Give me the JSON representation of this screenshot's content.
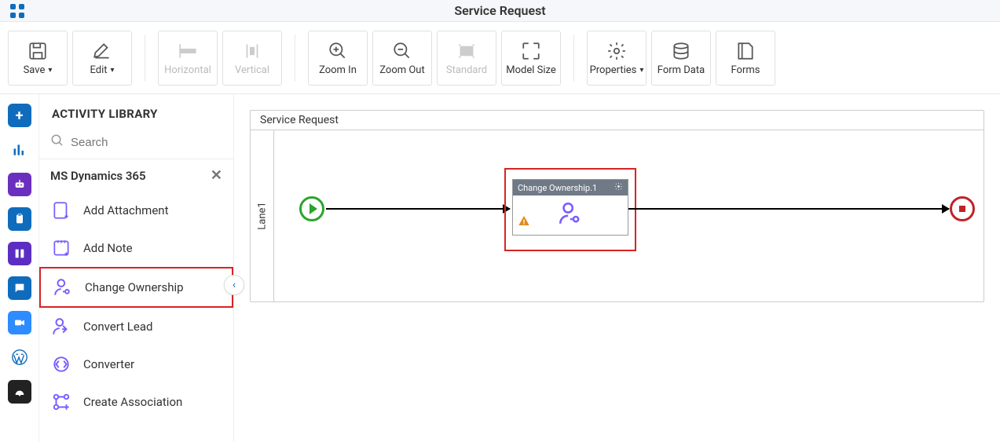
{
  "header": {
    "title": "Service Request"
  },
  "toolbar": {
    "save": "Save",
    "edit": "Edit",
    "horizontal": "Horizontal",
    "vertical": "Vertical",
    "zoom_in": "Zoom In",
    "zoom_out": "Zoom Out",
    "standard": "Standard",
    "model_size": "Model Size",
    "properties": "Properties",
    "form_data": "Form Data",
    "forms": "Forms"
  },
  "sidebar": {
    "title": "ACTIVITY LIBRARY",
    "search_placeholder": "Search",
    "category": "MS Dynamics 365",
    "items": [
      {
        "label": "Add Attachment",
        "icon": "add-attachment"
      },
      {
        "label": "Add Note",
        "icon": "add-note"
      },
      {
        "label": "Change Ownership",
        "icon": "change-ownership",
        "highlight": true
      },
      {
        "label": "Convert Lead",
        "icon": "convert-lead"
      },
      {
        "label": "Converter",
        "icon": "converter"
      },
      {
        "label": "Create Association",
        "icon": "create-association"
      }
    ]
  },
  "canvas": {
    "pool_title": "Service Request",
    "lane_label": "Lane1",
    "activity_title": "Change Ownership.1"
  }
}
